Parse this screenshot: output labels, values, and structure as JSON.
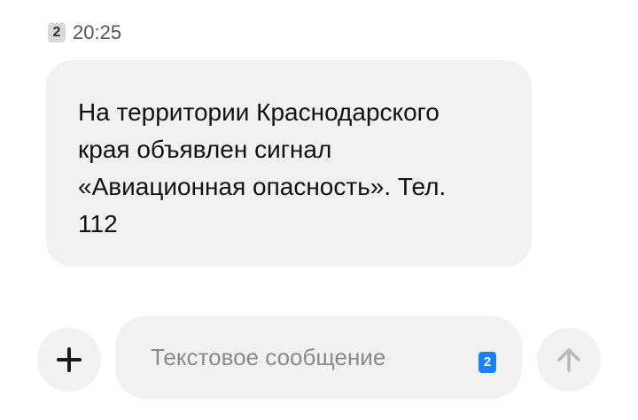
{
  "message": {
    "sim": "2",
    "time": "20:25",
    "text": "На территории Краснодарского\nкрая объявлен сигнал\n«Авиационная опасность». Тел.\n112"
  },
  "composer": {
    "attach_icon": "plus-icon",
    "placeholder": "Текстовое сообщение",
    "sim": "2",
    "send_icon": "arrow-up-icon"
  },
  "colors": {
    "bubble_bg": "#f1f1f1",
    "sim_accent": "#1a82f0"
  }
}
